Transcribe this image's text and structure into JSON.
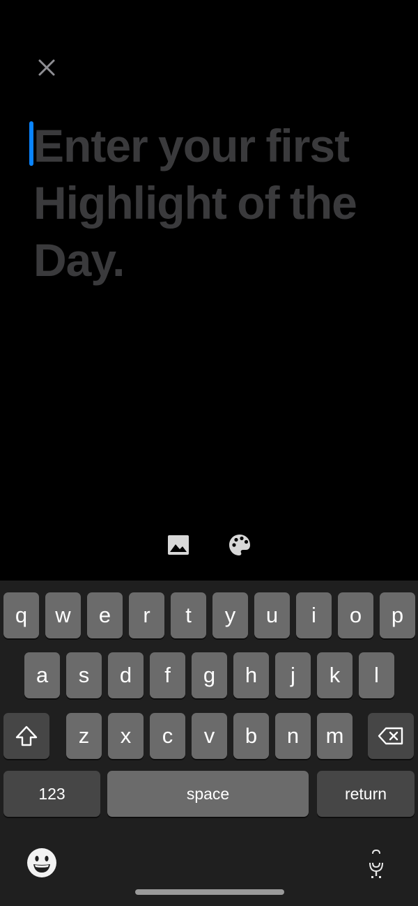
{
  "editor": {
    "placeholder": "Enter your first Highlight of the Day."
  },
  "colors": {
    "caret": "#0a84ff",
    "placeholder_text": "#3a3a3c",
    "background": "#000000",
    "keyboard_bg": "#1f1f1f",
    "key_light": "#6b6b6b",
    "key_dark": "#464646"
  },
  "icons": {
    "close": "close-icon",
    "image": "image-icon",
    "palette": "palette-icon",
    "shift": "shift-icon",
    "delete": "delete-icon",
    "emoji": "emoji-icon",
    "dictation": "microphone-icon"
  },
  "keyboard": {
    "row1": [
      "q",
      "w",
      "e",
      "r",
      "t",
      "y",
      "u",
      "i",
      "o",
      "p"
    ],
    "row2": [
      "a",
      "s",
      "d",
      "f",
      "g",
      "h",
      "j",
      "k",
      "l"
    ],
    "row3": [
      "z",
      "x",
      "c",
      "v",
      "b",
      "n",
      "m"
    ],
    "numbers_label": "123",
    "space_label": "space",
    "return_label": "return"
  }
}
